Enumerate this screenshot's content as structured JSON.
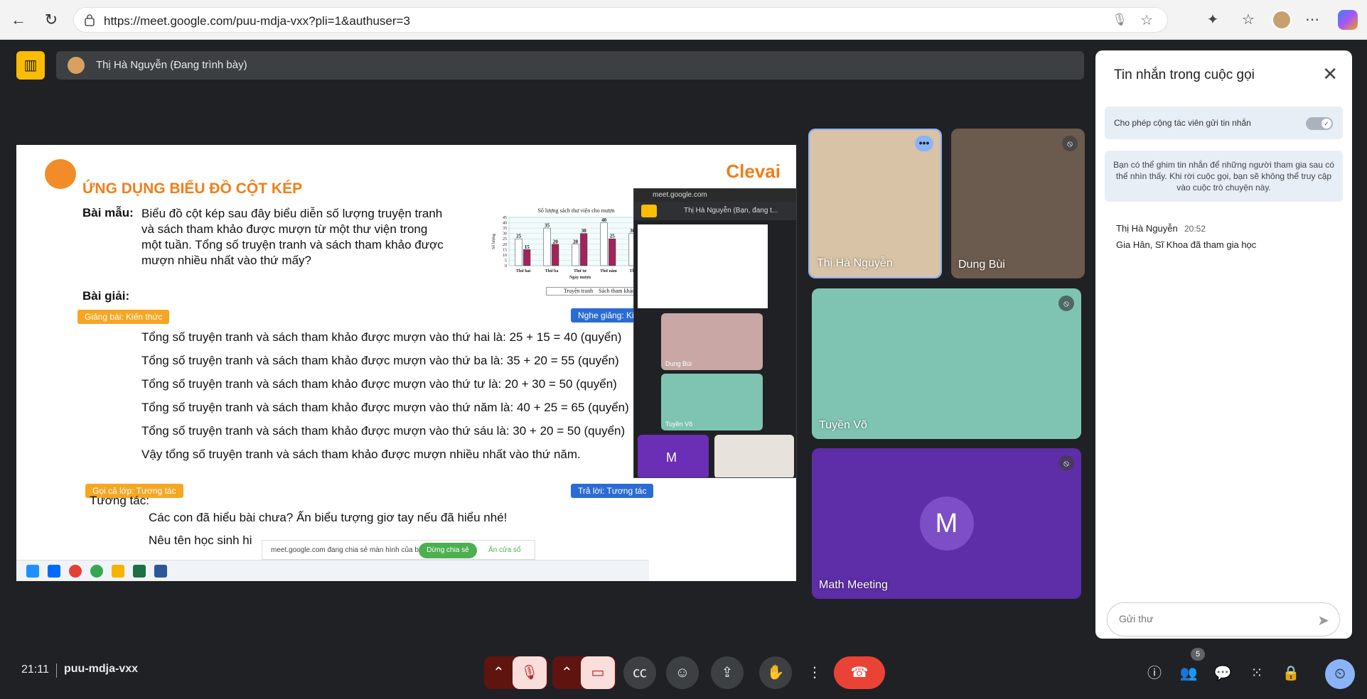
{
  "browser": {
    "url": "https://meet.google.com/puu-mdja-vxx?pli=1&authuser=3"
  },
  "meeting": {
    "presenter_label": "Thị Hà Nguyễn (Đang trình bày)",
    "time": "21:11",
    "code": "puu-mdja-vxx",
    "participants_count": "5"
  },
  "slide": {
    "title": "ỨNG DỤNG BIỂU ĐỒ CỘT KÉP",
    "brand": "Clevai",
    "example_label": "Bài mẫu:",
    "example_text_1": "Biểu đồ cột kép sau đây biểu diễn số lượng truyện tranh",
    "example_text_2": "và sách tham khảo được mượn từ một thư viện trong",
    "example_text_3": "một tuần. Tổng số truyện tranh và sách tham khảo được",
    "example_text_4": "mượn nhiều nhất vào thứ mấy?",
    "solution_label": "Bài giải:",
    "tag_lecture": "Giảng bài: Kiến thức",
    "tag_listen": "Nghe giảng: Kiến thức",
    "lines": [
      "Tổng số truyện tranh và sách tham khảo được mượn vào thứ hai là: 25 + 15 = 40 (quyển)",
      "Tổng số truyện tranh và sách tham khảo được mượn vào thứ ba là: 35 + 20 = 55 (quyển)",
      "Tổng số truyện tranh và sách tham khảo được mượn vào thứ tư là: 20 + 30 = 50 (quyển)",
      "Tổng số truyện tranh và sách tham khảo được mượn vào thứ năm là: 40 + 25 = 65 (quyển)",
      "Tổng số truyện tranh và sách tham khảo được mượn vào thứ sáu là: 30 + 20 = 50 (quyển)",
      "Vậy tổng số truyện tranh và sách tham khảo được mượn nhiều nhất vào thứ năm."
    ],
    "tag_call_class": "Gọi cả lớp: Tương tác",
    "tag_answer": "Trả lời: Tương tác",
    "interact_label": "Tương tác:",
    "interact_q1": "Các con đã hiểu bài chưa? Ấn biểu tượng giơ tay nếu đã hiểu nhé!",
    "interact_q2": "Nêu tên học sinh hi"
  },
  "chart_data": {
    "type": "bar",
    "title": "Số lượng sách thư viện cho mượn",
    "xlabel": "Ngày mượn",
    "ylabel": "Số lượng",
    "categories": [
      "Thứ hai",
      "Thứ ba",
      "Thứ tư",
      "Thứ năm",
      "Thứ sáu"
    ],
    "series": [
      {
        "name": "Truyện tranh",
        "values": [
          25,
          35,
          20,
          40,
          30
        ]
      },
      {
        "name": "Sách tham khảo",
        "values": [
          15,
          20,
          30,
          25,
          20
        ]
      }
    ],
    "ylim": [
      0,
      45
    ],
    "yticks": [
      0,
      5,
      10,
      15,
      20,
      25,
      30,
      35,
      40,
      45
    ],
    "colors": [
      "#ffffff",
      "#a3245c"
    ]
  },
  "share_note": {
    "text": "meet.google.com đang chia sẻ màn hình của bạn.",
    "stop": "Dừng chia sẻ",
    "hide": "Ẩn cửa sổ"
  },
  "pip": {
    "host": "meet.google.com",
    "name": "Thị Hà Nguyễn (Bạn, đang t...",
    "tile_a": "Dung Bùi",
    "tile_b": "Tuyền Võ",
    "tile_c": "M"
  },
  "tiles": [
    {
      "name": "Thị Hà Nguyễn",
      "color": "#d8c3a6"
    },
    {
      "name": "Dung Bùi",
      "color": "#6b5a4e"
    },
    {
      "name": "Tuyền Võ",
      "color": "#7fc4b2"
    },
    {
      "name": "Math Meeting",
      "initial": "M",
      "color": "#5e2da8"
    }
  ],
  "chat": {
    "title": "Tin nhắn trong cuộc gọi",
    "permission": "Cho phép cộng tác viên gửi tin nhắn",
    "info": "Bạn có thể ghim tin nhắn để những người tham gia sau có thể nhìn thấy. Khi rời cuộc gọi, bạn sẽ không thể truy cập vào cuộc trò chuyện này.",
    "author": "Thị Hà Nguyễn",
    "time": "20:52",
    "message": "Gia Hân, Sĩ Khoa đã tham gia học",
    "placeholder": "Gửi thư"
  }
}
